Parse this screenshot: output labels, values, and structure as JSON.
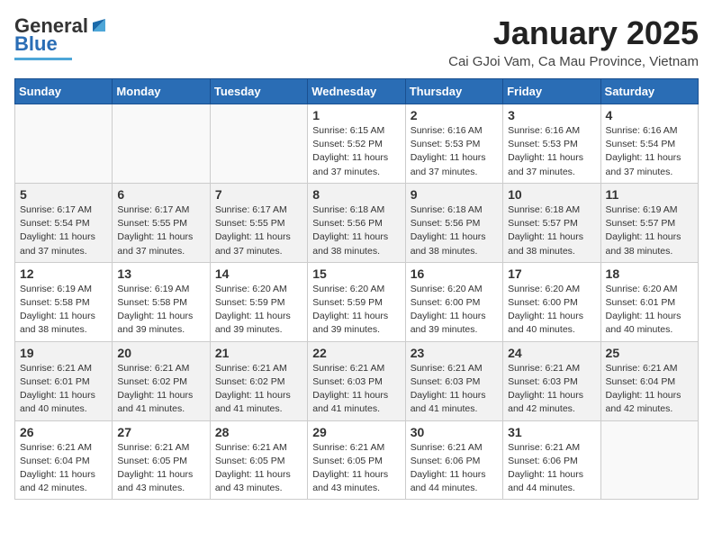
{
  "header": {
    "logo_general": "General",
    "logo_blue": "Blue",
    "month_title": "January 2025",
    "location": "Cai GJoi Vam, Ca Mau Province, Vietnam"
  },
  "weekdays": [
    "Sunday",
    "Monday",
    "Tuesday",
    "Wednesday",
    "Thursday",
    "Friday",
    "Saturday"
  ],
  "weeks": [
    [
      {
        "day": "",
        "info": ""
      },
      {
        "day": "",
        "info": ""
      },
      {
        "day": "",
        "info": ""
      },
      {
        "day": "1",
        "info": "Sunrise: 6:15 AM\nSunset: 5:52 PM\nDaylight: 11 hours and 37 minutes."
      },
      {
        "day": "2",
        "info": "Sunrise: 6:16 AM\nSunset: 5:53 PM\nDaylight: 11 hours and 37 minutes."
      },
      {
        "day": "3",
        "info": "Sunrise: 6:16 AM\nSunset: 5:53 PM\nDaylight: 11 hours and 37 minutes."
      },
      {
        "day": "4",
        "info": "Sunrise: 6:16 AM\nSunset: 5:54 PM\nDaylight: 11 hours and 37 minutes."
      }
    ],
    [
      {
        "day": "5",
        "info": "Sunrise: 6:17 AM\nSunset: 5:54 PM\nDaylight: 11 hours and 37 minutes."
      },
      {
        "day": "6",
        "info": "Sunrise: 6:17 AM\nSunset: 5:55 PM\nDaylight: 11 hours and 37 minutes."
      },
      {
        "day": "7",
        "info": "Sunrise: 6:17 AM\nSunset: 5:55 PM\nDaylight: 11 hours and 37 minutes."
      },
      {
        "day": "8",
        "info": "Sunrise: 6:18 AM\nSunset: 5:56 PM\nDaylight: 11 hours and 38 minutes."
      },
      {
        "day": "9",
        "info": "Sunrise: 6:18 AM\nSunset: 5:56 PM\nDaylight: 11 hours and 38 minutes."
      },
      {
        "day": "10",
        "info": "Sunrise: 6:18 AM\nSunset: 5:57 PM\nDaylight: 11 hours and 38 minutes."
      },
      {
        "day": "11",
        "info": "Sunrise: 6:19 AM\nSunset: 5:57 PM\nDaylight: 11 hours and 38 minutes."
      }
    ],
    [
      {
        "day": "12",
        "info": "Sunrise: 6:19 AM\nSunset: 5:58 PM\nDaylight: 11 hours and 38 minutes."
      },
      {
        "day": "13",
        "info": "Sunrise: 6:19 AM\nSunset: 5:58 PM\nDaylight: 11 hours and 39 minutes."
      },
      {
        "day": "14",
        "info": "Sunrise: 6:20 AM\nSunset: 5:59 PM\nDaylight: 11 hours and 39 minutes."
      },
      {
        "day": "15",
        "info": "Sunrise: 6:20 AM\nSunset: 5:59 PM\nDaylight: 11 hours and 39 minutes."
      },
      {
        "day": "16",
        "info": "Sunrise: 6:20 AM\nSunset: 6:00 PM\nDaylight: 11 hours and 39 minutes."
      },
      {
        "day": "17",
        "info": "Sunrise: 6:20 AM\nSunset: 6:00 PM\nDaylight: 11 hours and 40 minutes."
      },
      {
        "day": "18",
        "info": "Sunrise: 6:20 AM\nSunset: 6:01 PM\nDaylight: 11 hours and 40 minutes."
      }
    ],
    [
      {
        "day": "19",
        "info": "Sunrise: 6:21 AM\nSunset: 6:01 PM\nDaylight: 11 hours and 40 minutes."
      },
      {
        "day": "20",
        "info": "Sunrise: 6:21 AM\nSunset: 6:02 PM\nDaylight: 11 hours and 41 minutes."
      },
      {
        "day": "21",
        "info": "Sunrise: 6:21 AM\nSunset: 6:02 PM\nDaylight: 11 hours and 41 minutes."
      },
      {
        "day": "22",
        "info": "Sunrise: 6:21 AM\nSunset: 6:03 PM\nDaylight: 11 hours and 41 minutes."
      },
      {
        "day": "23",
        "info": "Sunrise: 6:21 AM\nSunset: 6:03 PM\nDaylight: 11 hours and 41 minutes."
      },
      {
        "day": "24",
        "info": "Sunrise: 6:21 AM\nSunset: 6:03 PM\nDaylight: 11 hours and 42 minutes."
      },
      {
        "day": "25",
        "info": "Sunrise: 6:21 AM\nSunset: 6:04 PM\nDaylight: 11 hours and 42 minutes."
      }
    ],
    [
      {
        "day": "26",
        "info": "Sunrise: 6:21 AM\nSunset: 6:04 PM\nDaylight: 11 hours and 42 minutes."
      },
      {
        "day": "27",
        "info": "Sunrise: 6:21 AM\nSunset: 6:05 PM\nDaylight: 11 hours and 43 minutes."
      },
      {
        "day": "28",
        "info": "Sunrise: 6:21 AM\nSunset: 6:05 PM\nDaylight: 11 hours and 43 minutes."
      },
      {
        "day": "29",
        "info": "Sunrise: 6:21 AM\nSunset: 6:05 PM\nDaylight: 11 hours and 43 minutes."
      },
      {
        "day": "30",
        "info": "Sunrise: 6:21 AM\nSunset: 6:06 PM\nDaylight: 11 hours and 44 minutes."
      },
      {
        "day": "31",
        "info": "Sunrise: 6:21 AM\nSunset: 6:06 PM\nDaylight: 11 hours and 44 minutes."
      },
      {
        "day": "",
        "info": ""
      }
    ]
  ]
}
